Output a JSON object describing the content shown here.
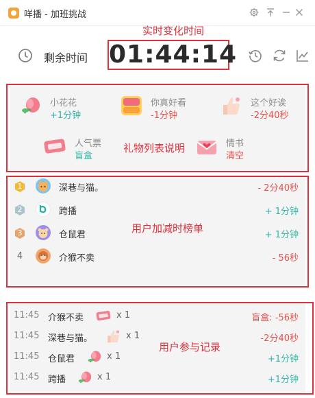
{
  "window": {
    "title": "咩播 - 加班挑战",
    "icons": [
      "app-logo-icon",
      "gear-icon",
      "pin-top-icon",
      "minimize-icon",
      "close-icon"
    ]
  },
  "timer": {
    "label": "剩余时间",
    "value": "01:44:14",
    "icons": [
      "clock-icon",
      "history-icon",
      "refresh-icon",
      "chart-icon"
    ]
  },
  "annotations": {
    "timer": "实时变化时间",
    "gifts": "礼物列表说明",
    "ranking": "用户加减时榜单",
    "records": "用户参与记录"
  },
  "gifts": [
    {
      "name": "小花花",
      "effect": "+1分钟",
      "kind": "pos",
      "icon": "peach-flower-icon"
    },
    {
      "name": "你真好看",
      "effect": "-1分钟",
      "kind": "neg",
      "icon": "you-look-good-badge-icon"
    },
    {
      "name": "这个好诶",
      "effect": "-2分40秒",
      "kind": "neg",
      "icon": "thumbs-up-icon"
    },
    {
      "name": "人气票",
      "effect": "盲盒",
      "kind": "pos",
      "icon": "popularity-ticket-icon"
    },
    {
      "name": "情书",
      "effect": "清空",
      "kind": "neg",
      "icon": "love-letter-icon"
    }
  ],
  "ranking": [
    {
      "rank": "1",
      "name": "深巷与猫。",
      "delta": "- 2分40秒",
      "kind": "neg",
      "avatar": "cat-avatar"
    },
    {
      "rank": "2",
      "name": "跨播",
      "delta": "+ 1分钟",
      "kind": "pos",
      "avatar": "kuabo-logo-avatar"
    },
    {
      "rank": "3",
      "name": "仓鼠君",
      "delta": "+ 1分钟",
      "kind": "pos",
      "avatar": "hamster-avatar"
    },
    {
      "rank": "4",
      "name": "介猴不卖",
      "delta": "- 56秒",
      "kind": "neg",
      "avatar": "monkey-avatar"
    }
  ],
  "records": [
    {
      "time": "11:45",
      "user": "介猴不卖",
      "gift": "popularity-ticket-icon",
      "count": "x 1",
      "delta": "盲盒: -56秒",
      "kind": "neg"
    },
    {
      "time": "11:45",
      "user": "深巷与猫。",
      "gift": "thumbs-up-icon",
      "count": "x 1",
      "delta": "-2分40秒",
      "kind": "neg"
    },
    {
      "time": "11:45",
      "user": "仓鼠君",
      "gift": "peach-flower-icon",
      "count": "x 1",
      "delta": "+1分钟",
      "kind": "pos"
    },
    {
      "time": "11:45",
      "user": "跨播",
      "gift": "peach-flower-icon",
      "count": "x 1",
      "delta": "+1分钟",
      "kind": "pos"
    }
  ],
  "colors": {
    "annotation_red": "#e0303c",
    "positive": "#2fb7a8",
    "negative": "#e8504b",
    "panel_bg": "#f4f4f4"
  }
}
